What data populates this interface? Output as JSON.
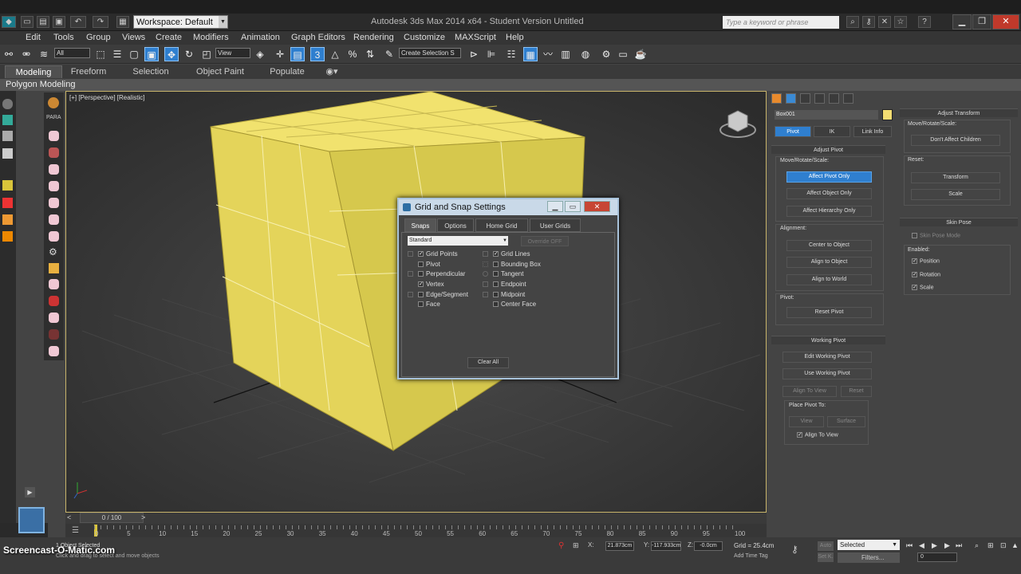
{
  "titlebar": {
    "workspace": "Workspace: Default",
    "title": "Autodesk 3ds Max  2014 x64  - Student Version   Untitled",
    "search_placeholder": "Type a keyword or phrase"
  },
  "menu": [
    "Edit",
    "Tools",
    "Group",
    "Views",
    "Create",
    "Modifiers",
    "Animation",
    "Graph Editors",
    "Rendering",
    "Customize",
    "MAXScript",
    "Help"
  ],
  "toolbar": {
    "filter": "All",
    "refcoord": "View",
    "selset": "Create Selection S"
  },
  "ribbon": {
    "tabs": [
      "Modeling",
      "Freeform",
      "Selection",
      "Object Paint",
      "Populate"
    ],
    "active": "Modeling",
    "sub": "Polygon Modeling"
  },
  "viewport": {
    "label": "[+] [Perspective] [Realistic]",
    "para": "PARA"
  },
  "dialog": {
    "title": "Grid and Snap Settings",
    "tabs": [
      "Snaps",
      "Options",
      "Home Grid",
      "User Grids"
    ],
    "select": "Standard",
    "override": "Override OFF",
    "left_snaps": [
      {
        "label": "Grid Points",
        "checked": "✓"
      },
      {
        "label": "Pivot",
        "checked": ""
      },
      {
        "label": "Perpendicular",
        "checked": ""
      },
      {
        "label": "Vertex",
        "checked": "✓"
      },
      {
        "label": "Edge/Segment",
        "checked": ""
      },
      {
        "label": "Face",
        "checked": ""
      }
    ],
    "right_snaps": [
      {
        "label": "Grid Lines",
        "checked": "✓"
      },
      {
        "label": "Bounding Box",
        "checked": ""
      },
      {
        "label": "Tangent",
        "checked": ""
      },
      {
        "label": "Endpoint",
        "checked": ""
      },
      {
        "label": "Midpoint",
        "checked": ""
      },
      {
        "label": "Center Face",
        "checked": ""
      }
    ],
    "clear_all": "Clear All"
  },
  "command_panel": {
    "object_name": "Box001",
    "object_color": "#f4dd72",
    "subtabs": [
      "Pivot",
      "IK",
      "Link Info"
    ],
    "adjust_pivot": {
      "header": "Adjust Pivot",
      "move_label": "Move/Rotate/Scale:",
      "buttons": [
        "Affect Pivot Only",
        "Affect Object Only",
        "Affect Hierarchy Only"
      ],
      "alignment_label": "Alignment:",
      "align_buttons": [
        "Center to Object",
        "Align to Object",
        "Align to World"
      ],
      "pivot_label": "Pivot:",
      "reset_pivot": "Reset Pivot"
    },
    "working_pivot": {
      "header": "Working Pivot",
      "edit": "Edit Working Pivot",
      "use": "Use Working Pivot",
      "align_view": "Align To View",
      "reset": "Reset",
      "place_label": "Place Pivot To:",
      "view": "View",
      "surface": "Surface",
      "align_to_view_check": "Align To View"
    }
  },
  "right_panel": {
    "adjust_transform": "Adjust Transform",
    "move_label": "Move/Rotate/Scale:",
    "dont_affect": "Don't Affect Children",
    "reset_label": "Reset:",
    "transform": "Transform",
    "scale": "Scale",
    "skin_pose": "Skin Pose",
    "skin_pose_mode": "Skin Pose Mode",
    "enabled_label": "Enabled:",
    "position": "Position",
    "rotation": "Rotation",
    "scale_chk": "Scale"
  },
  "timeline": {
    "frame": "0 / 100",
    "ticks": [
      "0",
      "5",
      "10",
      "15",
      "20",
      "25",
      "30",
      "35",
      "40",
      "45",
      "50",
      "55",
      "60",
      "65",
      "70",
      "75",
      "80",
      "85",
      "90",
      "95",
      "100"
    ]
  },
  "status": {
    "selected": "1 Object Selected",
    "hint": "Click and drag to select and move objects",
    "x": "21.873cm",
    "y": "-117.933cm",
    "z": "-0.0cm",
    "grid": "Grid = 25.4cm",
    "add_time_tag": "Add Time Tag",
    "auto": "Auto",
    "set_key": "Set K.",
    "selected_dropdown": "Selected",
    "filters": "Filters...",
    "frame_value": "0",
    "screencast": "Screencast-O-Matic.com"
  }
}
